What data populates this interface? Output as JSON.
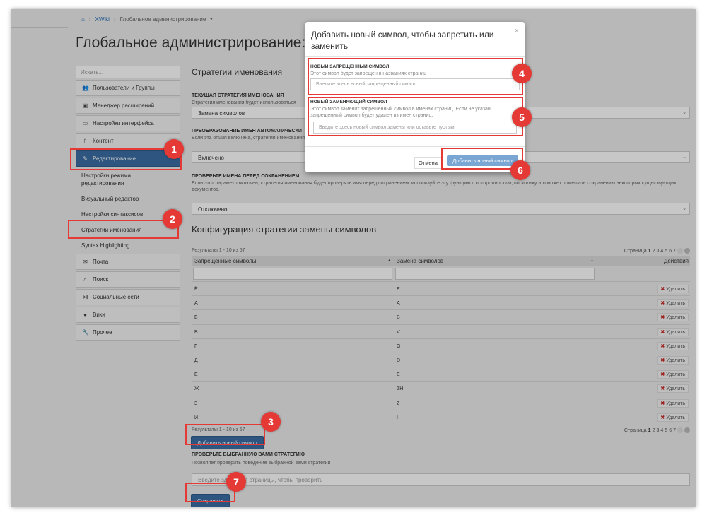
{
  "breadcrumb": {
    "home_icon": "home-icon",
    "items": [
      "XWiki",
      "Глобальное администрирование"
    ]
  },
  "page_title": "Глобальное администрирование: Стратегии именования",
  "sidebar": {
    "search_placeholder": "Искать...",
    "items": [
      {
        "label": "Пользователи и Группы",
        "icon": "users-icon"
      },
      {
        "label": "Менеджер расширений",
        "icon": "briefcase-icon"
      },
      {
        "label": "Настройки интерфейса",
        "icon": "window-icon"
      },
      {
        "label": "Контент",
        "icon": "file-icon"
      },
      {
        "label": "Редактирование",
        "icon": "pencil-icon"
      },
      {
        "label": "Почта",
        "icon": "mail-icon"
      },
      {
        "label": "Поиск",
        "icon": "search-icon"
      },
      {
        "label": "Социальные сети",
        "icon": "share-icon"
      },
      {
        "label": "Вики",
        "icon": "globe-icon"
      },
      {
        "label": "Прочее",
        "icon": "wrench-icon"
      }
    ],
    "sub_items": [
      "Настройки режима редактирования",
      "Визуальный редактор",
      "Настройки синтаксисов",
      "Стратегии именования",
      "Syntax Highlighting"
    ]
  },
  "main": {
    "title": "Стратегии именования",
    "current_strategy": {
      "label": "ТЕКУЩАЯ СТРАТЕГИЯ ИМЕНОВАНИЯ",
      "hint": "Стратегия именования будет использоваться",
      "value": "Замена символов"
    },
    "auto_transform": {
      "label": "ПРЕОБРАЗОВАНИЕ ИМЕН АВТОМАТИЧЕСКИ",
      "hint": "Если эта опция включена, стратегия именования",
      "value": "Включено"
    },
    "check_names": {
      "label": "ПРОВЕРЬТЕ ИМЕНА ПЕРЕД СОХРАНЕНИЕМ",
      "hint": "Если этот параметр включен, стратегия именования будет проверять имя перед сохранением: используйте эту функцию с осторожностью, поскольку это может помешать сохранению некоторых существующих документов.",
      "value": "Отключено"
    },
    "config_title": "Конфигурация стратегии замены символов",
    "results": "Результаты 1 - 10 из 67",
    "pager_label": "Страница",
    "pages": [
      "1",
      "2",
      "3",
      "4",
      "5",
      "6",
      "7"
    ],
    "columns": [
      "Запрещенные символы",
      "Замена символов",
      "Действия"
    ],
    "rows": [
      [
        "Ё",
        "E"
      ],
      [
        "А",
        "A"
      ],
      [
        "Б",
        "B"
      ],
      [
        "В",
        "V"
      ],
      [
        "Г",
        "G"
      ],
      [
        "Д",
        "D"
      ],
      [
        "Е",
        "E"
      ],
      [
        "Ж",
        "ZH"
      ],
      [
        "З",
        "Z"
      ],
      [
        "И",
        "I"
      ]
    ],
    "delete_label": "Удалить",
    "add_button": "Добавить новый символ",
    "verify": {
      "label": "ПРОВЕРЬТЕ ВЫБРАННУЮ ВАМИ СТРАТЕГИЮ",
      "hint": "Позволяет проверить поведение выбранной вами стратегии",
      "placeholder": "Введите здесь имя страницы, чтобы проверить"
    },
    "save_button": "Сохранить"
  },
  "modal": {
    "title": "Добавить новый символ, чтобы запретить или заменить",
    "close": "×",
    "forbidden": {
      "label": "НОВЫЙ ЗАПРЕЩЕННЫЙ СИМВОЛ",
      "hint": "Этот символ будет запрещен в названиях страниц",
      "placeholder": "Введите здесь новый запрещенный символ"
    },
    "replacement": {
      "label": "НОВЫЙ ЗАМЕНЯЮЩИЙ СИМВОЛ",
      "hint": "Этот символ заменит запрещенный символ в именах страниц. Если не указан, запрещенный символ будет удален из имен страниц.",
      "placeholder": "Введите здесь новый символ замены или оставьте пустым"
    },
    "cancel": "Отмена",
    "submit": "Добавить новый символ"
  },
  "annotations": [
    "1",
    "2",
    "3",
    "4",
    "5",
    "6",
    "7"
  ],
  "colors": {
    "primary": "#3a6ea5",
    "highlight": "#e53935",
    "modal_button": "#7aa6d4"
  }
}
